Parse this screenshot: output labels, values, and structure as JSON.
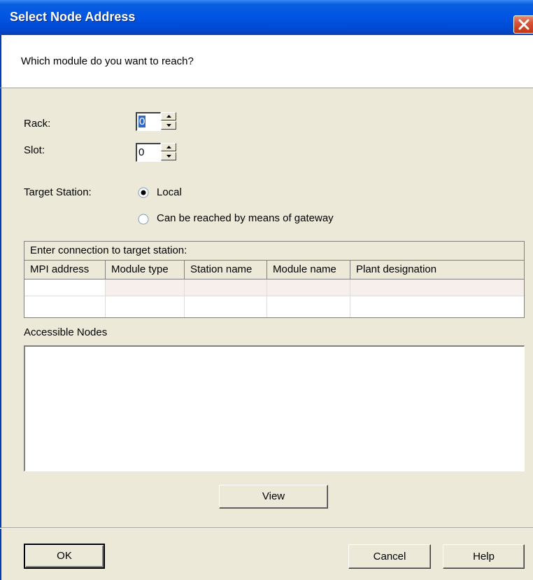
{
  "window": {
    "title": "Select Node Address",
    "close_icon": "close-icon"
  },
  "prompt": "Which module do you want to reach?",
  "rack": {
    "label": "Rack:",
    "value": "0"
  },
  "slot": {
    "label": "Slot:",
    "value": "0"
  },
  "target_station": {
    "label": "Target Station:",
    "options": [
      {
        "label": "Local",
        "selected": true
      },
      {
        "label": "Can be reached by means of gateway",
        "selected": false
      }
    ]
  },
  "connection_table": {
    "caption": "Enter connection to target station:",
    "columns": [
      "MPI address",
      "Module type",
      "Station name",
      "Module name",
      "Plant designation"
    ],
    "rows": [
      [
        "",
        "",
        "",
        "",
        ""
      ],
      [
        "",
        "",
        "",
        "",
        ""
      ]
    ]
  },
  "accessible_nodes": {
    "label": "Accessible Nodes",
    "items": []
  },
  "buttons": {
    "view": "View",
    "ok": "OK",
    "cancel": "Cancel",
    "help": "Help"
  },
  "colors": {
    "title_bar": "#0054e3",
    "dialog_bg": "#ece9d8",
    "close_button": "#c2350f",
    "selection": "#316ac5"
  }
}
